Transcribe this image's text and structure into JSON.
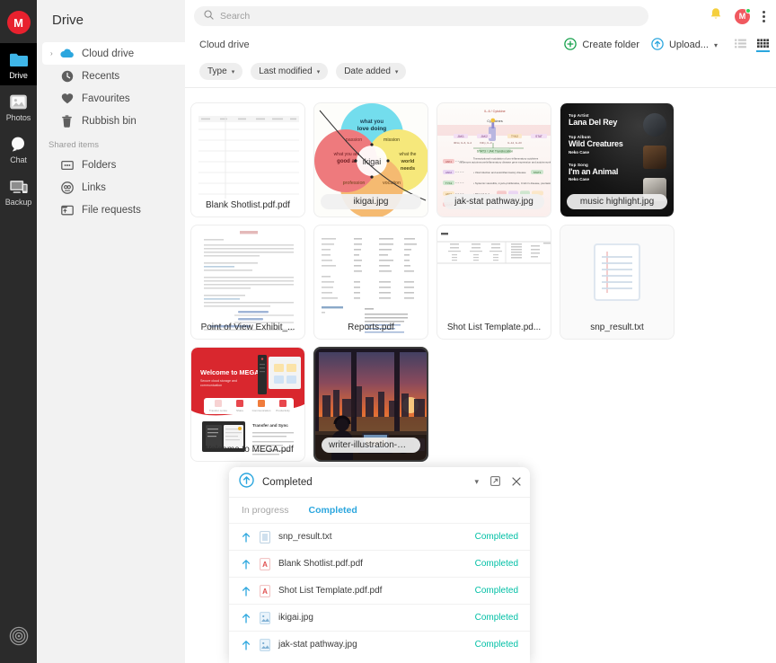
{
  "rail": {
    "logo_label": "M",
    "items": [
      {
        "label": "Drive",
        "icon": "folder-icon",
        "active": true
      },
      {
        "label": "Photos",
        "icon": "photos-icon",
        "active": false
      },
      {
        "label": "Chat",
        "icon": "chat-icon",
        "active": false
      },
      {
        "label": "Backup",
        "icon": "backup-icon",
        "active": false
      }
    ],
    "bottom_icon": "settings-logo-icon"
  },
  "sidebar": {
    "title": "Drive",
    "items": [
      {
        "label": "Cloud drive",
        "icon": "cloud-icon",
        "selected": true,
        "caret": "›"
      },
      {
        "label": "Recents",
        "icon": "clock-icon",
        "selected": false
      },
      {
        "label": "Favourites",
        "icon": "heart-icon",
        "selected": false
      },
      {
        "label": "Rubbish bin",
        "icon": "trash-icon",
        "selected": false
      }
    ],
    "section_label": "Shared items",
    "shared_items": [
      {
        "label": "Folders",
        "icon": "shared-folder-icon"
      },
      {
        "label": "Links",
        "icon": "link-icon"
      },
      {
        "label": "File requests",
        "icon": "file-request-icon"
      }
    ]
  },
  "search": {
    "placeholder": "Search",
    "icon": "search-icon"
  },
  "topbar": {
    "notifications_icon": "bell-icon",
    "avatar_letter": "M",
    "menu_icon": "kebab-menu-icon"
  },
  "breadcrumb": {
    "label": "Cloud drive"
  },
  "actions": {
    "create_folder": "Create folder",
    "upload": "Upload...",
    "list_view_icon": "list-view-icon",
    "grid_view_icon": "grid-view-icon"
  },
  "filters": [
    {
      "label": "Type"
    },
    {
      "label": "Last modified"
    },
    {
      "label": "Date added"
    }
  ],
  "files": [
    {
      "name": "Blank Shotlist.pdf.pdf",
      "thumb": "spreadsheet-doc",
      "label_style": "plain",
      "selected": false
    },
    {
      "name": "ikigai.jpg",
      "thumb": "ikigai-venn",
      "label_style": "pill",
      "selected": false
    },
    {
      "name": "jak-stat pathway.jpg",
      "thumb": "pathway-diagram",
      "label_style": "pill",
      "selected": false
    },
    {
      "name": "music highlight.jpg",
      "thumb": "music-card",
      "label_style": "pill",
      "selected": false
    },
    {
      "name": "Point of View Exhibit_...",
      "thumb": "text-doc",
      "label_style": "plain",
      "selected": false
    },
    {
      "name": "Reports.pdf",
      "thumb": "report-doc",
      "label_style": "plain",
      "selected": false
    },
    {
      "name": "Shot List Template.pd...",
      "thumb": "shotlist-doc",
      "label_style": "plain",
      "selected": false
    },
    {
      "name": "snp_result.txt",
      "thumb": "txt-file-icon",
      "label_style": "plain",
      "selected": false
    },
    {
      "name": "Welcome to MEGA.pdf",
      "thumb": "mega-promo",
      "label_style": "plain",
      "selected": false
    },
    {
      "name": "writer-illustration-mid...",
      "thumb": "city-sunset",
      "label_style": "pill",
      "selected": true
    }
  ],
  "music_card": {
    "rows": [
      {
        "heading": "Top Artist",
        "title": "Lana Del Rey",
        "sub": ""
      },
      {
        "heading": "Top Album",
        "title": "Wild Creatures",
        "sub": "Neko Case"
      },
      {
        "heading": "Top Song",
        "title": "I'm an Animal",
        "sub": "Neko Case"
      }
    ]
  },
  "promo_card": {
    "headline": "Welcome to MEGA",
    "sub": "Secure cloud storage and communication",
    "section": "Transfer and Sync"
  },
  "transfer_panel": {
    "title": "Completed",
    "header_icon": "upload-circle-icon",
    "collapse_icon": "chevron-down-icon",
    "popout_icon": "popout-icon",
    "close_icon": "close-icon",
    "tabs": [
      {
        "label": "In progress",
        "active": false
      },
      {
        "label": "Completed",
        "active": true
      }
    ],
    "rows": [
      {
        "name": "snp_result.txt",
        "type": "txt",
        "status": "Completed"
      },
      {
        "name": "Blank Shotlist.pdf.pdf",
        "type": "pdf",
        "status": "Completed"
      },
      {
        "name": "Shot List Template.pdf.pdf",
        "type": "pdf",
        "status": "Completed"
      },
      {
        "name": "ikigai.jpg",
        "type": "img",
        "status": "Completed"
      },
      {
        "name": "jak-stat pathway.jpg",
        "type": "img",
        "status": "Completed"
      }
    ]
  },
  "colors": {
    "brand_red": "#e8212e",
    "accent_blue": "#2ba6de",
    "success_green": "#00bfa5",
    "create_green": "#14a04a",
    "rail_bg": "#2b2b2b",
    "sidebar_bg": "#f2f2f2"
  }
}
